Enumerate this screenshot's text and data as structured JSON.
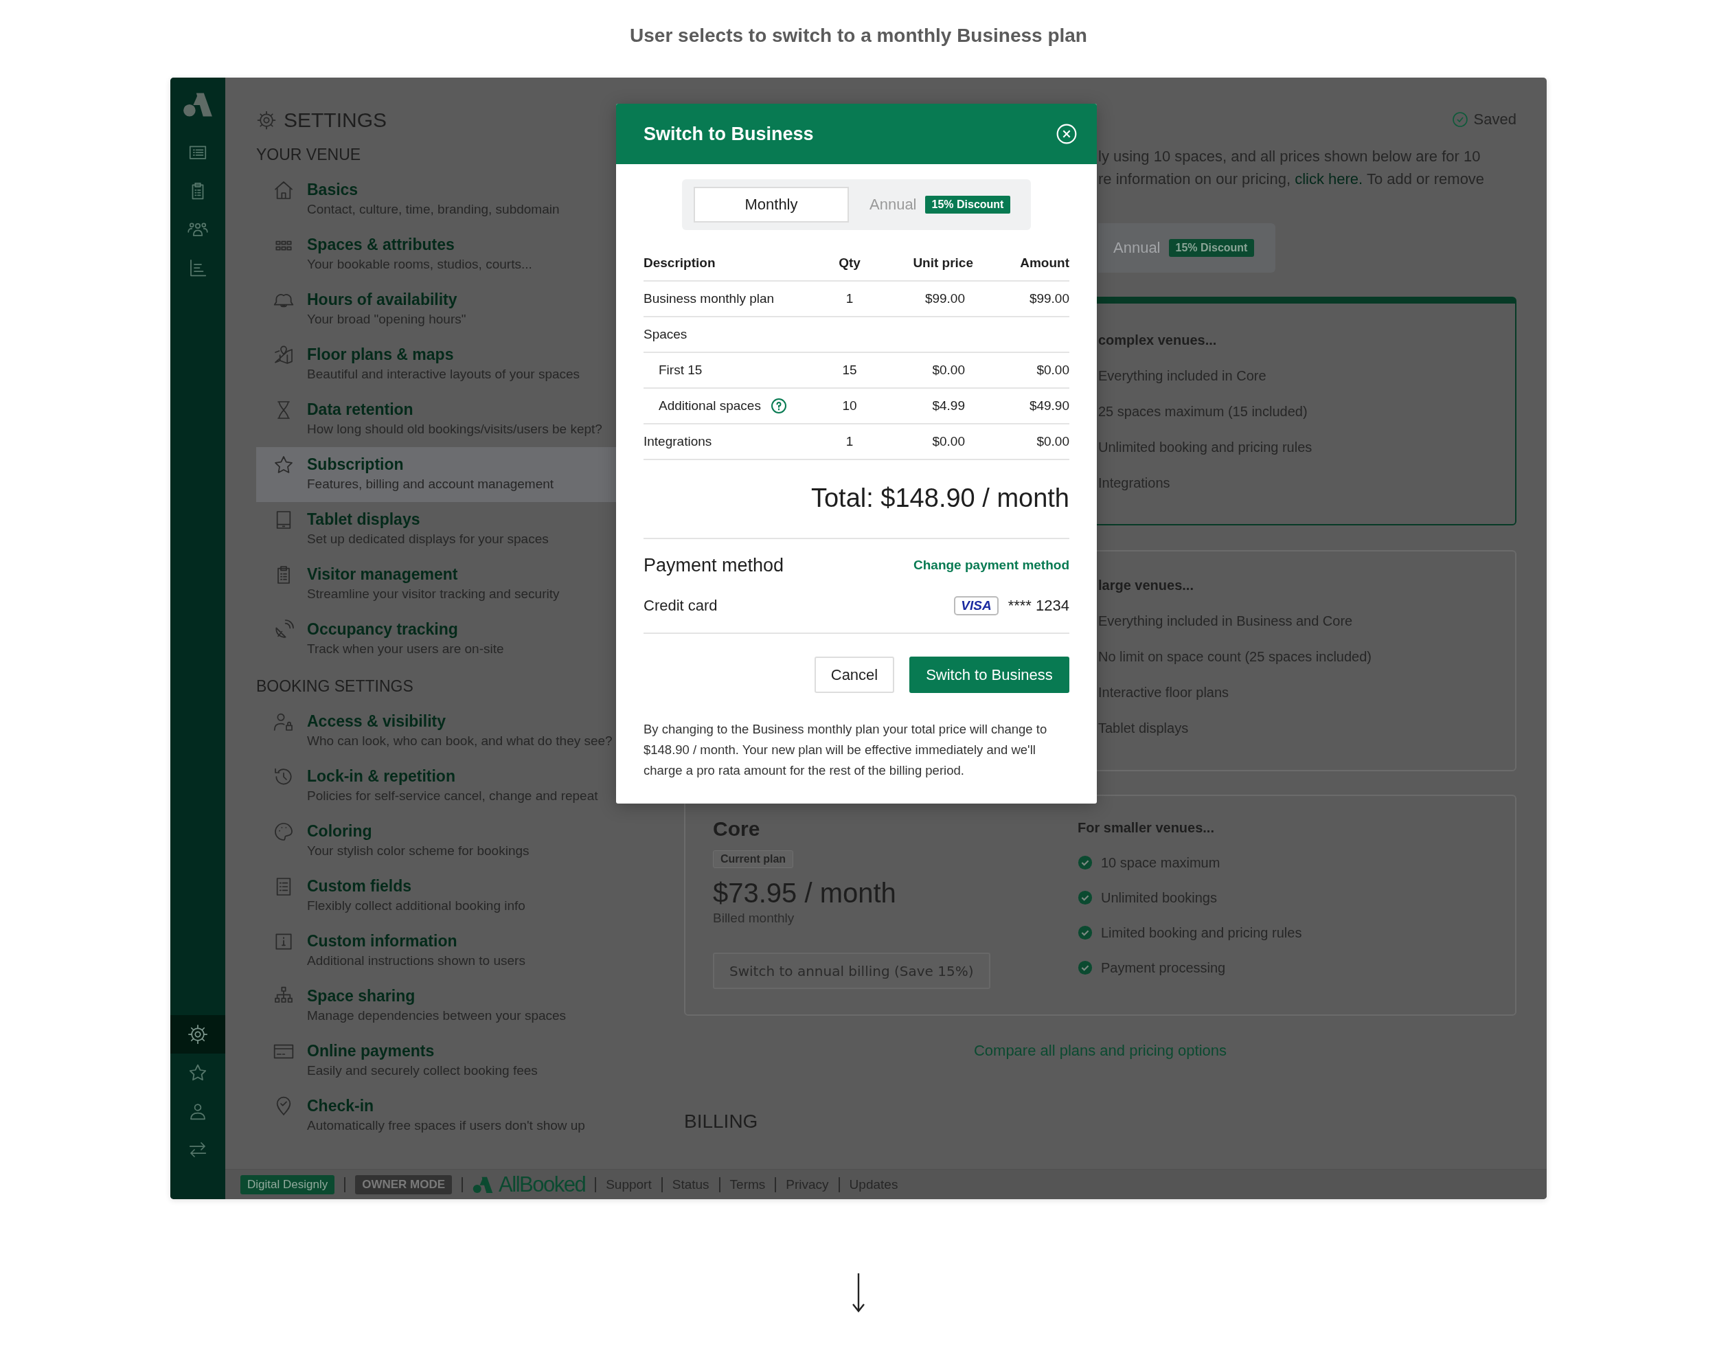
{
  "caption": "User selects to switch to a monthly Business plan",
  "rail": {
    "top": [
      {
        "selected": false
      },
      {
        "selected": false
      },
      {
        "selected": false
      },
      {
        "selected": false
      }
    ],
    "bottom": [
      {
        "selected": true
      },
      {
        "selected": false
      },
      {
        "selected": false
      },
      {
        "selected": false
      }
    ]
  },
  "settings": {
    "title": "SETTINGS",
    "sections": [
      {
        "heading": "YOUR VENUE",
        "items": [
          {
            "title": "Basics",
            "description": "Contact, culture, time, branding, subdomain",
            "selected": false
          },
          {
            "title": "Spaces & attributes",
            "description": "Your bookable rooms, studios, courts...",
            "selected": false
          },
          {
            "title": "Hours of availability",
            "description": "Your broad \"opening hours\"",
            "selected": false
          },
          {
            "title": "Floor plans & maps",
            "description": "Beautiful and interactive layouts of your spaces",
            "selected": false
          },
          {
            "title": "Data retention",
            "description": "How long should old bookings/visits/users be kept?",
            "selected": false
          },
          {
            "title": "Subscription",
            "description": "Features, billing and account management",
            "selected": true
          },
          {
            "title": "Tablet displays",
            "description": "Set up dedicated displays for your spaces",
            "selected": false
          },
          {
            "title": "Visitor management",
            "description": "Streamline your visitor tracking and security",
            "selected": false
          },
          {
            "title": "Occupancy tracking",
            "description": "Track when your users are on-site",
            "selected": false
          }
        ]
      },
      {
        "heading": "BOOKING SETTINGS",
        "items": [
          {
            "title": "Access & visibility",
            "description": "Who can look, who can book, and what do they see?",
            "selected": false
          },
          {
            "title": "Lock-in & repetition",
            "description": "Policies for self-service cancel, change and repeat",
            "selected": false
          },
          {
            "title": "Coloring",
            "description": "Your stylish color scheme for bookings",
            "selected": false
          },
          {
            "title": "Custom fields",
            "description": "Flexibly collect additional booking info",
            "selected": false
          },
          {
            "title": "Custom information",
            "description": "Additional instructions shown to users",
            "selected": false
          },
          {
            "title": "Space sharing",
            "description": "Manage dependencies between your spaces",
            "selected": false
          },
          {
            "title": "Online payments",
            "description": "Easily and securely collect booking fees",
            "selected": false
          },
          {
            "title": "Check-in",
            "description": "Automatically free spaces if users don't show up",
            "selected": false
          }
        ]
      }
    ]
  },
  "status": {
    "label": "Saved"
  },
  "intro": {
    "line_1": "ly using 10 spaces, and all prices shown below are for 10",
    "line_2_before": "re information on our pricing, ",
    "line_2_link": "click here.",
    "line_2_after": " To add or remove"
  },
  "billing_toggle": [
    {
      "label": "Annual",
      "badge": "15% Discount",
      "selected": false
    }
  ],
  "plans": [
    {
      "kind": "partial",
      "selected": true,
      "heading": "complex venues...",
      "features": [
        "Everything included in Core",
        "25 spaces maximum (15 included)",
        "Unlimited booking and pricing rules",
        "Integrations"
      ]
    },
    {
      "kind": "partial",
      "selected": false,
      "heading": "large venues...",
      "features": [
        "Everything included in Business and Core",
        "No limit on space count (25 spaces included)",
        "Interactive floor plans",
        "Tablet displays"
      ]
    },
    {
      "kind": "full",
      "selected": false,
      "name": "Core",
      "badge": "Current plan",
      "price": "$73.95 / month",
      "billing": "Billed monthly",
      "button": "Switch to annual billing (Save 15%)",
      "heading": "For smaller venues...",
      "features": [
        "10 space maximum",
        "Unlimited bookings",
        "Limited booking and pricing rules",
        "Payment processing"
      ]
    }
  ],
  "compare_link": "Compare all plans and pricing options",
  "billing_heading": "BILLING",
  "footer": {
    "company": "Digital Designly",
    "mode": "OWNER MODE",
    "brand": "AllBooked",
    "links": [
      "Support",
      "Status",
      "Terms",
      "Privacy",
      "Updates"
    ]
  },
  "modal": {
    "title": "Switch to Business",
    "periods": [
      {
        "label": "Monthly",
        "selected": true
      },
      {
        "label": "Annual",
        "badge": "15% Discount",
        "selected": false
      }
    ],
    "columns": [
      "Description",
      "Qty",
      "Unit price",
      "Amount"
    ],
    "rows": [
      {
        "description": "Business monthly plan",
        "qty": "1",
        "unit_price": "$99.00",
        "amount": "$99.00",
        "help": false
      },
      {
        "description": "Spaces",
        "help": false,
        "children": [
          {
            "description": "First 15",
            "qty": "15",
            "unit_price": "$0.00",
            "amount": "$0.00",
            "help": false
          },
          {
            "description": "Additional spaces",
            "qty": "10",
            "unit_price": "$4.99",
            "amount": "$49.90",
            "help": true
          }
        ]
      },
      {
        "description": "Integrations",
        "qty": "1",
        "unit_price": "$0.00",
        "amount": "$0.00",
        "help": false
      }
    ],
    "total": "Total: $148.90 / month",
    "payment": {
      "heading": "Payment method",
      "change_link": "Change payment method",
      "method": "Credit card",
      "brand": "VISA",
      "number": "**** 1234"
    },
    "buttons": {
      "cancel": "Cancel",
      "confirm": "Switch to Business"
    },
    "note": "By changing to the Business monthly plan your total price will change to $148.90 / month. Your new plan will be effective immediately and we'll charge a pro rata amount for the rest of the billing period."
  }
}
